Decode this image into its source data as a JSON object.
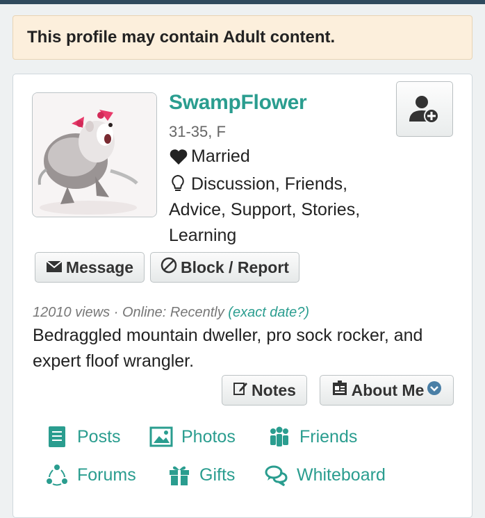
{
  "warning": {
    "text": "This profile may contain Adult content."
  },
  "profile": {
    "username": "SwampFlower",
    "age_sex": "31-35, F",
    "relationship": "Married",
    "looking_for": "Discussion, Friends, Advice, Support, Stories, Learning",
    "views": "12010 views",
    "online": "· Online: Recently",
    "exact_date_link": "(exact date?)",
    "bio": "Bedraggled mountain dweller, pro sock rocker, and expert floof wrangler."
  },
  "buttons": {
    "message": "Message",
    "block_report": "Block / Report",
    "notes": "Notes",
    "about_me": "About Me"
  },
  "tabs": [
    {
      "label": "Posts",
      "icon": "document-icon"
    },
    {
      "label": "Photos",
      "icon": "image-icon"
    },
    {
      "label": "Friends",
      "icon": "people-icon"
    },
    {
      "label": "Forums",
      "icon": "forums-icon"
    },
    {
      "label": "Gifts",
      "icon": "gift-icon"
    },
    {
      "label": "Whiteboard",
      "icon": "chat-bubbles-icon"
    }
  ],
  "colors": {
    "accent": "#2a9d8f",
    "warning_bg": "#fcefdc",
    "header": "#2f4a5e"
  }
}
